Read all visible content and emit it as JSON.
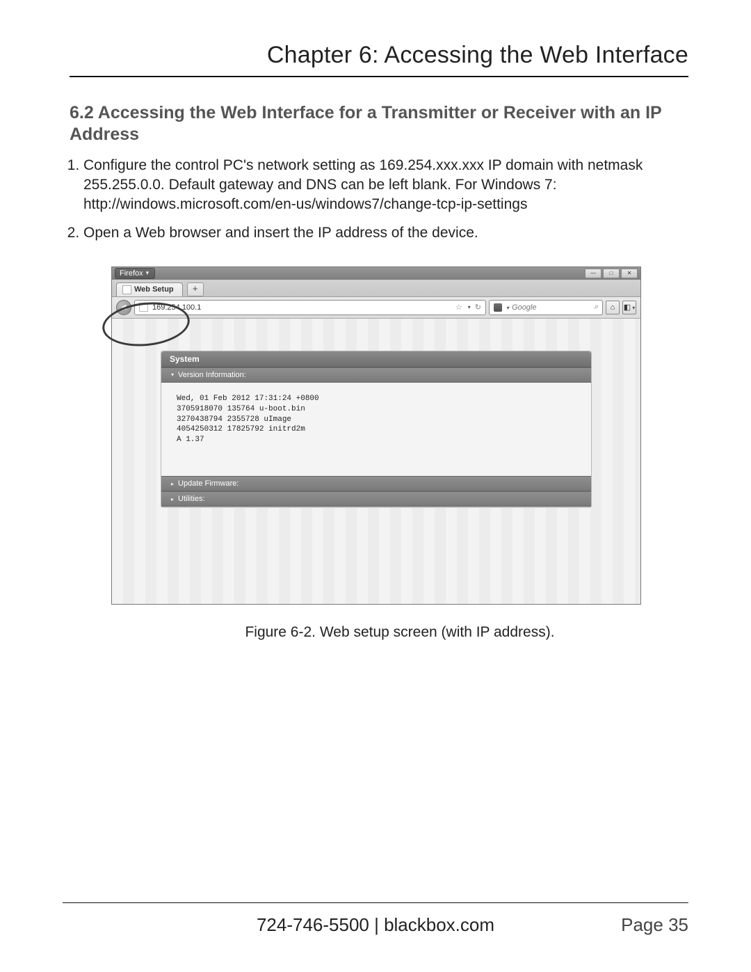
{
  "chapter_title": "Chapter 6: Accessing the Web Interface",
  "section_title": "6.2 Accessing the Web Interface for a Transmitter or Receiver with an IP Address",
  "steps": [
    "Configure the control PC's network setting as 169.254.xxx.xxx IP domain with netmask 255.255.0.0. Default gateway and DNS can be left blank. For Windows 7: http://windows.microsoft.com/en-us/windows7/change-tcp-ip-settings",
    "Open a Web browser and insert the IP address of the device."
  ],
  "browser": {
    "app_button": "Firefox",
    "win_min": "—",
    "win_max": "□",
    "win_close": "✕",
    "tab_label": "Web Setup",
    "new_tab": "+",
    "nav_back": "◄",
    "url": "169.254.100.1",
    "star": "☆",
    "refresh": "↻",
    "search_placeholder": "Google",
    "search_go": "⌕",
    "home": "⌂",
    "bookmark_menu": "◧"
  },
  "webpage": {
    "panel_title": "System",
    "section_version": "Version Information:",
    "version_text": "Wed, 01 Feb 2012 17:31:24 +0800\n3705918070 135764 u-boot.bin\n3270438794 2355728 uImage\n4054250312 17825792 initrd2m\nA 1.37",
    "section_update": "Update Firmware:",
    "section_utilities": "Utilities:"
  },
  "caption": "Figure 6-2. Web setup screen (with IP address).",
  "footer": {
    "phone_site": "724-746-5500   |   blackbox.com",
    "page": "Page 35"
  }
}
